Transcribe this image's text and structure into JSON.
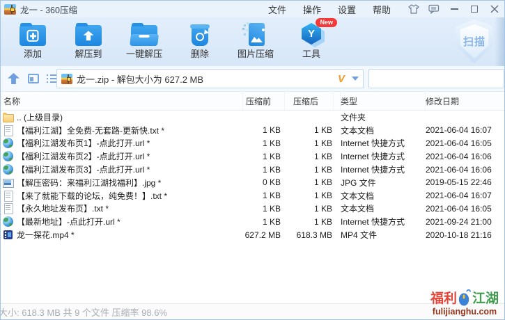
{
  "window": {
    "title": "龙一 - 360压缩"
  },
  "menu": {
    "items": [
      {
        "label": "文件"
      },
      {
        "label": "操作"
      },
      {
        "label": "设置"
      },
      {
        "label": "帮助"
      }
    ]
  },
  "toolbar": {
    "buttons": [
      {
        "label": "添加"
      },
      {
        "label": "解压到"
      },
      {
        "label": "一键解压"
      },
      {
        "label": "删除"
      },
      {
        "label": "图片压缩"
      },
      {
        "label": "工具",
        "badge": "New"
      }
    ],
    "scan_label": "扫描"
  },
  "pathbar": {
    "archive_text": "龙一.zip - 解包大小为 627.2 MB",
    "format_badge": "V",
    "search_placeholder": ""
  },
  "table": {
    "columns": [
      "名称",
      "压缩前",
      "压缩后",
      "类型",
      "修改日期"
    ],
    "rows": [
      {
        "icon": "folder",
        "name": ".. (上级目录)",
        "before": "",
        "after": "",
        "type": "文件夹",
        "date": ""
      },
      {
        "icon": "txt",
        "name": "【福利江湖】全免费-无套路-更新快.txt *",
        "before": "1 KB",
        "after": "1 KB",
        "type": "文本文档",
        "date": "2021-06-04 16:07"
      },
      {
        "icon": "url",
        "name": "【福利江湖发布页1】-点此打开.url *",
        "before": "1 KB",
        "after": "1 KB",
        "type": "Internet 快捷方式",
        "date": "2021-06-04 16:05"
      },
      {
        "icon": "url",
        "name": "【福利江湖发布页2】-点此打开.url *",
        "before": "1 KB",
        "after": "1 KB",
        "type": "Internet 快捷方式",
        "date": "2021-06-04 16:06"
      },
      {
        "icon": "url",
        "name": "【福利江湖发布页3】-点此打开.url *",
        "before": "1 KB",
        "after": "1 KB",
        "type": "Internet 快捷方式",
        "date": "2021-06-04 16:06"
      },
      {
        "icon": "jpg",
        "name": "【解压密码：来福利江湖找福利】.jpg *",
        "before": "0 KB",
        "after": "1 KB",
        "type": "JPG 文件",
        "date": "2019-05-15 22:46"
      },
      {
        "icon": "txt",
        "name": "【来了就能下载的论坛，纯免费！】.txt *",
        "before": "1 KB",
        "after": "1 KB",
        "type": "文本文档",
        "date": "2021-06-04 16:07"
      },
      {
        "icon": "txt",
        "name": "【永久地址发布页】.txt *",
        "before": "1 KB",
        "after": "1 KB",
        "type": "文本文档",
        "date": "2021-06-04 16:05"
      },
      {
        "icon": "url",
        "name": "【最新地址】-点此打开.url *",
        "before": "1 KB",
        "after": "1 KB",
        "type": "Internet 快捷方式",
        "date": "2021-09-24 21:00"
      },
      {
        "icon": "mp4",
        "name": "龙一探花.mp4 *",
        "before": "627.2 MB",
        "after": "618.3 MB",
        "type": "MP4 文件",
        "date": "2020-10-18 21:16"
      }
    ]
  },
  "statusbar": {
    "text": "大小: 618.3 MB 共 9 个文件 压缩率 98.6%"
  },
  "watermark": {
    "brand_left": "福利",
    "brand_right": "江湖",
    "domain": "fulijianghu.com"
  },
  "colors": {
    "accent_blue": "#1d86e0",
    "toolbar_bg": "#dcebfa",
    "badge_red": "#f23a3a",
    "format_v_orange": "#f59a23",
    "wm_red": "#e2453a",
    "wm_green": "#3f9e4d",
    "wm_blue": "#3b82d8",
    "wm_domain": "#99341c"
  }
}
